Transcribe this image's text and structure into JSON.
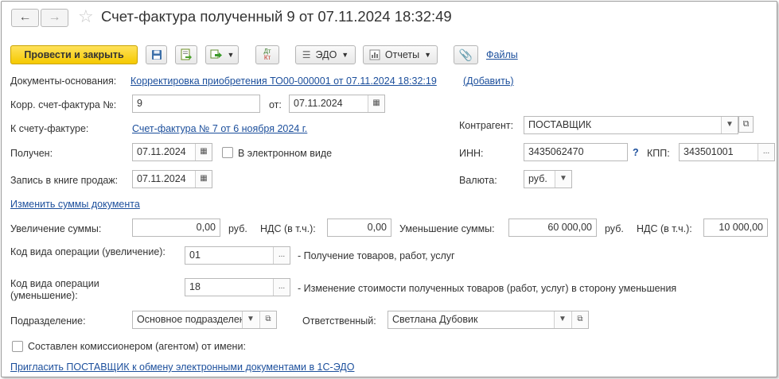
{
  "window": {
    "title": "Счет-фактура полученный 9 от 07.11.2024 18:32:49"
  },
  "toolbar": {
    "post_close": "Провести и закрыть",
    "edo": "ЭДО",
    "reports": "Отчеты",
    "dtkt_top": "Дт",
    "dtkt_bottom": "Кт",
    "files": "Файлы"
  },
  "basis": {
    "label": "Документы-основания:",
    "link": "Корректировка приобретения ТО00-000001 от 07.11.2024 18:32:19",
    "add": "(Добавить)"
  },
  "corr": {
    "label": "Корр. счет-фактура №:",
    "number": "9",
    "date_label": "от:",
    "date": "07.11.2024"
  },
  "to_invoice": {
    "label": "К счету-фактуре:",
    "link": "Счет-фактура № 7 от 6 ноября 2024 г."
  },
  "counterparty": {
    "label": "Контрагент:",
    "value": "ПОСТАВЩИК"
  },
  "received": {
    "label": "Получен:",
    "date": "07.11.2024",
    "electronic_label": "В электронном виде"
  },
  "inn": {
    "label": "ИНН:",
    "value": "3435062470",
    "help": "?",
    "kpp_label": "КПП:",
    "kpp_value": "343501001"
  },
  "sales_book": {
    "label": "Запись в книге продаж:",
    "date": "07.11.2024"
  },
  "currency": {
    "label": "Валюта:",
    "value": "руб."
  },
  "change_sums_link": "Изменить суммы документа",
  "sums": {
    "increase_label": "Увеличение суммы:",
    "increase_value": "0,00",
    "rub1": "руб.",
    "vat1_label": "НДС (в т.ч.):",
    "vat1_value": "0,00",
    "decrease_label": "Уменьшение суммы:",
    "decrease_value": "60 000,00",
    "rub2": "руб.",
    "vat2_label": "НДС (в т.ч.):",
    "vat2_value": "10 000,00"
  },
  "op_increase": {
    "label": "Код вида операции (увеличение):",
    "value": "01",
    "description": "- Получение товаров, работ, услуг"
  },
  "op_decrease": {
    "label_line1": "Код вида операции",
    "label_line2": "(уменьшение):",
    "value": "18",
    "description": "- Изменение стоимости полученных товаров (работ, услуг) в сторону уменьшения"
  },
  "department": {
    "label": "Подразделение:",
    "value": "Основное подразделение"
  },
  "responsible": {
    "label": "Ответственный:",
    "value": "Светлана Дубовик"
  },
  "agent": {
    "label": "Составлен комиссионером (агентом) от имени:"
  },
  "invite_link": "Пригласить ПОСТАВЩИК к обмену электронными документами в 1С-ЭДО"
}
